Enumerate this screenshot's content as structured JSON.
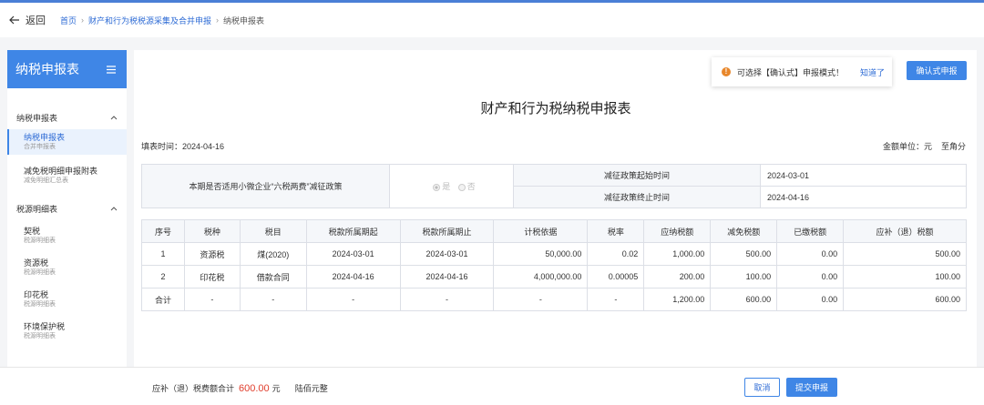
{
  "header": {
    "back_label": "返回",
    "breadcrumbs": [
      "首页",
      "财产和行为税税源采集及合并申报",
      "纳税申报表"
    ]
  },
  "sidebar": {
    "title": "纳税申报表",
    "groups": [
      {
        "label": "纳税申报表",
        "items": [
          {
            "label": "纳税申报表",
            "sub": "合并申报表",
            "active": true
          },
          {
            "label": "减免税明细申报附表",
            "sub": "减免明细汇总表"
          }
        ]
      },
      {
        "label": "税源明细表",
        "items": [
          {
            "label": "契税",
            "sub": "税源明细表"
          },
          {
            "label": "资源税",
            "sub": "税源明细表"
          },
          {
            "label": "印花税",
            "sub": "税源明细表"
          },
          {
            "label": "环境保护税",
            "sub": "税源明细表"
          }
        ]
      }
    ]
  },
  "notice": {
    "icon": "warning-icon",
    "text": "可选择【确认式】申报模式！",
    "link": "知道了"
  },
  "confirm_button": "确认式申报",
  "main": {
    "title": "财产和行为税纳税申报表",
    "fill_date": "填表时间：2024-04-16",
    "unit": "金额单位：元",
    "unit_precision": "至角分"
  },
  "policy": {
    "question": "本期是否适用小微企业“六税两费”减征政策",
    "options": [
      "是",
      "否"
    ],
    "selected": "是",
    "start_label": "减征政策起始时间",
    "start_value": "2024-03-01",
    "end_label": "减征政策终止时间",
    "end_value": "2024-04-16"
  },
  "table": {
    "headers": [
      "序号",
      "税种",
      "税目",
      "税款所属期起",
      "税款所属期止",
      "计税依据",
      "税率",
      "应纳税额",
      "减免税额",
      "已缴税额",
      "应补（退）税额"
    ],
    "rows": [
      [
        "1",
        "资源税",
        "煤(2020)",
        "2024-03-01",
        "2024-03-01",
        "50,000.00",
        "0.02",
        "1,000.00",
        "500.00",
        "0.00",
        "500.00"
      ],
      [
        "2",
        "印花税",
        "借款合同",
        "2024-04-16",
        "2024-04-16",
        "4,000,000.00",
        "0.00005",
        "200.00",
        "100.00",
        "0.00",
        "100.00"
      ],
      [
        "合计",
        "-",
        "-",
        "-",
        "-",
        "-",
        "-",
        "1,200.00",
        "600.00",
        "0.00",
        "600.00"
      ]
    ]
  },
  "footer": {
    "summary_label": "应补（退）税费额合计",
    "summary_amount": "600.00",
    "currency": "元",
    "amount_words": "陆佰元整",
    "cancel": "取消",
    "submit": "提交申报"
  },
  "colors": {
    "primary": "#3f86e6",
    "amount": "#e03e2d",
    "warning": "#e8872b"
  }
}
